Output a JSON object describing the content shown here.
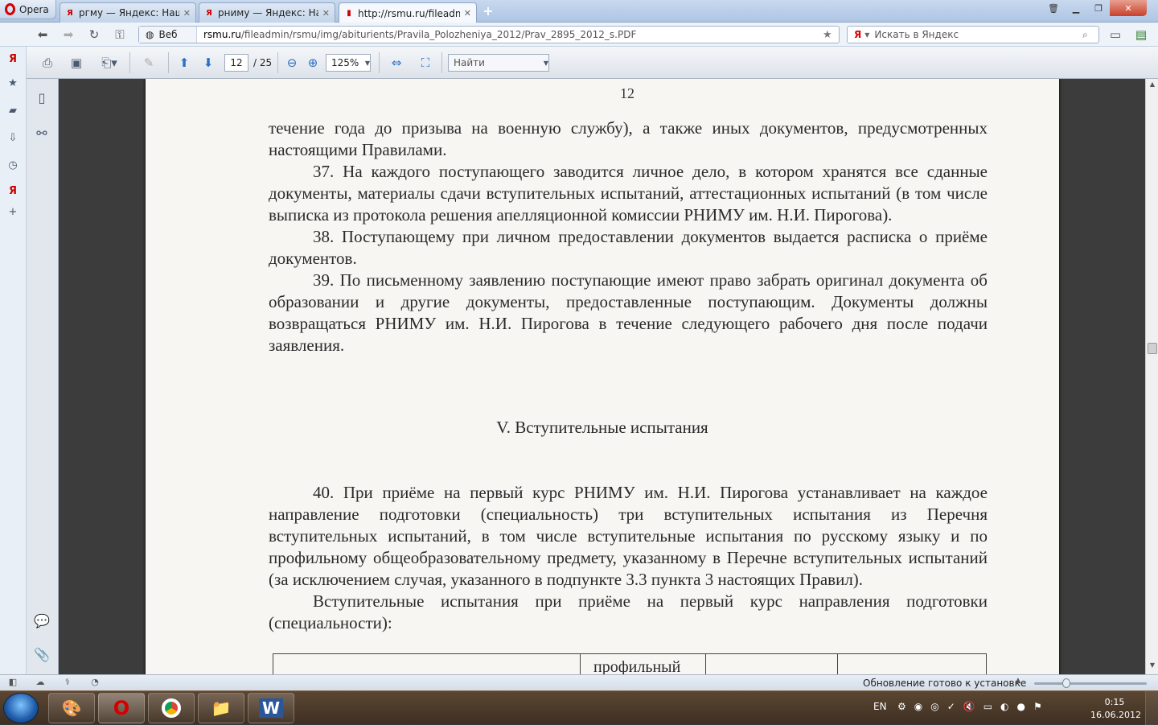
{
  "browser": {
    "menu_label": "Opera",
    "tabs": [
      {
        "title": "ргму — Яндекс: Нашл...",
        "favicon": "Я"
      },
      {
        "title": "рниму — Яндекс: На......",
        "favicon": "Я"
      },
      {
        "title": "http://rsmu.ru/fileadm...",
        "favicon": "pdf"
      }
    ],
    "new_tab": "+",
    "address": {
      "mode_label": "Веб",
      "domain": "rsmu.ru",
      "path": "/fileadmin/rsmu/img/abiturients/Pravila_Polozheniya_2012/Prav_2895_2012_s.PDF"
    },
    "search_placeholder": "Искать в Яндекс",
    "search_brand": "Я"
  },
  "pdf_toolbar": {
    "current_page": "12",
    "total_pages": "/ 25",
    "zoom": "125%",
    "find_placeholder": "Найти"
  },
  "document": {
    "page_number": "12",
    "paragraphs_top": [
      {
        "text": "течение года до призыва на военную службу), а также иных документов, предусмотренных настоящими Правилами.",
        "indent": false
      },
      {
        "text": "37. На каждого поступающего заводится личное дело, в котором хранятся все сданные документы, материалы сдачи вступительных испытаний, аттестационных испытаний (в том числе выписка из протокола решения апелляционной комиссии РНИМУ им. Н.И. Пирогова).",
        "indent": true
      },
      {
        "text": "38. Поступающему при личном предоставлении документов выдается расписка о приёме документов.",
        "indent": true
      },
      {
        "text": "39. По письменному заявлению поступающие имеют право забрать оригинал документа об образовании и другие документы, предоставленные поступающим. Документы должны возвращаться РНИМУ им. Н.И. Пирогова в течение следующего рабочего дня после подачи заявления.",
        "indent": true
      }
    ],
    "section_heading": "V. Вступительные испытания",
    "paragraphs_bottom": [
      {
        "text": "40. При приёме на первый курс РНИМУ им. Н.И. Пирогова устанавливает на каждое направление подготовки (специальность) три вступительных испытания из Перечня вступительных испытаний, в том числе вступительные испытания по русскому языку и по профильному общеобразовательному предмету, указанному в Перечне вступительных испытаний (за исключением случая, указанного в подпункте 3.3 пункта 3 настоящих Правил).",
        "indent": true
      },
      {
        "text": "Вступительные испытания при приёме на первый курс направления подготовки (специальности):",
        "indent": true
      }
    ],
    "table_cell": "профильный"
  },
  "status": {
    "update_text": "Обновление готово к установке"
  },
  "taskbar": {
    "language": "EN",
    "time": "0:15",
    "date": "16.06.2012"
  }
}
